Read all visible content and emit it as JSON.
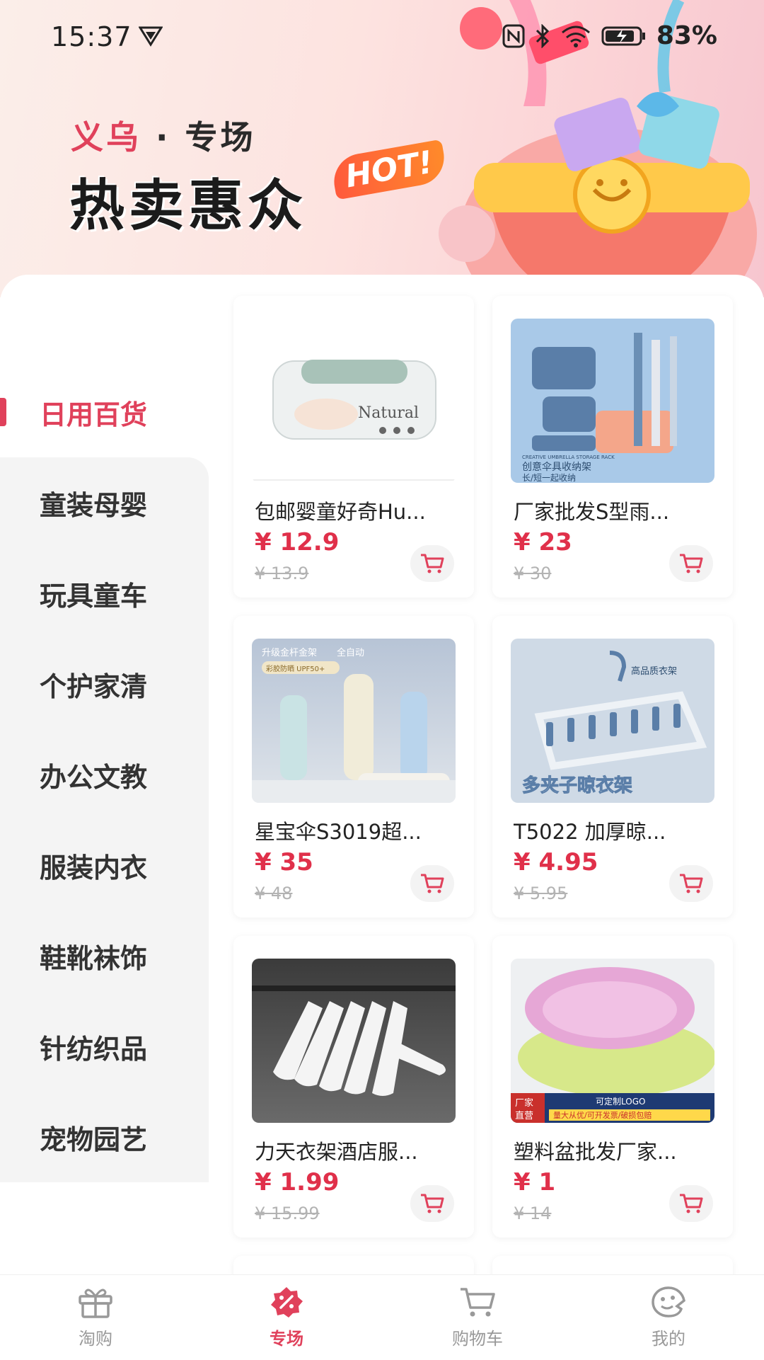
{
  "status_bar": {
    "time": "15:37",
    "battery": "83%"
  },
  "banner": {
    "subtitle_red": "义乌",
    "subtitle_dark": " · 专场",
    "title": "热卖惠众",
    "badge": "HOT!"
  },
  "sidebar": {
    "items": [
      {
        "label": "日用百货",
        "active": true
      },
      {
        "label": "童装母婴"
      },
      {
        "label": "玩具童车"
      },
      {
        "label": "个护家清"
      },
      {
        "label": "办公文教"
      },
      {
        "label": "服装内衣"
      },
      {
        "label": "鞋靴袜饰"
      },
      {
        "label": "针纺织品"
      },
      {
        "label": "宠物园艺"
      }
    ]
  },
  "products": [
    {
      "name": "包邮婴童好奇Hu...",
      "price": "¥ 12.9",
      "orig": "¥ 13.9"
    },
    {
      "name": "厂家批发S型雨...",
      "price": "¥ 23",
      "orig": "¥ 30"
    },
    {
      "name": "星宝伞S3019超...",
      "price": "¥ 35",
      "orig": "¥ 48"
    },
    {
      "name": "T5022 加厚晾...",
      "price": "¥ 4.95",
      "orig": "¥ 5.95"
    },
    {
      "name": "力天衣架酒店服...",
      "price": "¥ 1.99",
      "orig": "¥ 15.99"
    },
    {
      "name": "塑料盆批发厂家...",
      "price": "¥ 1",
      "orig": "¥ 14"
    }
  ],
  "image_text": {
    "umbrella_rack_title": "创意伞具收纳架",
    "umbrella_rack_sub": "长/短一起收纳",
    "umbrella_rack_en": "CREATIVE UMBRELLA STORAGE RACK",
    "umbrella_tag1": "升级金杆金架",
    "umbrella_tag2": "全自动",
    "umbrella_tag3": "彩胶防晒 UPF50+",
    "hanger_title": "多夹子晾衣架",
    "hanger_tag": "高品质衣架",
    "basin_tag1": "厂家",
    "basin_tag2": "直营",
    "basin_logo": "可定制LOGO",
    "basin_promo": "量大从优/可开发票/破损包赔",
    "wipes_brand": "Natural"
  },
  "bottom_nav": [
    {
      "label": "淘购",
      "icon": "gift-icon"
    },
    {
      "label": "专场",
      "icon": "special-icon",
      "active": true
    },
    {
      "label": "购物车",
      "icon": "cart-icon"
    },
    {
      "label": "我的",
      "icon": "profile-icon"
    }
  ],
  "colors": {
    "accent": "#e0415b",
    "price": "#e0304a"
  }
}
